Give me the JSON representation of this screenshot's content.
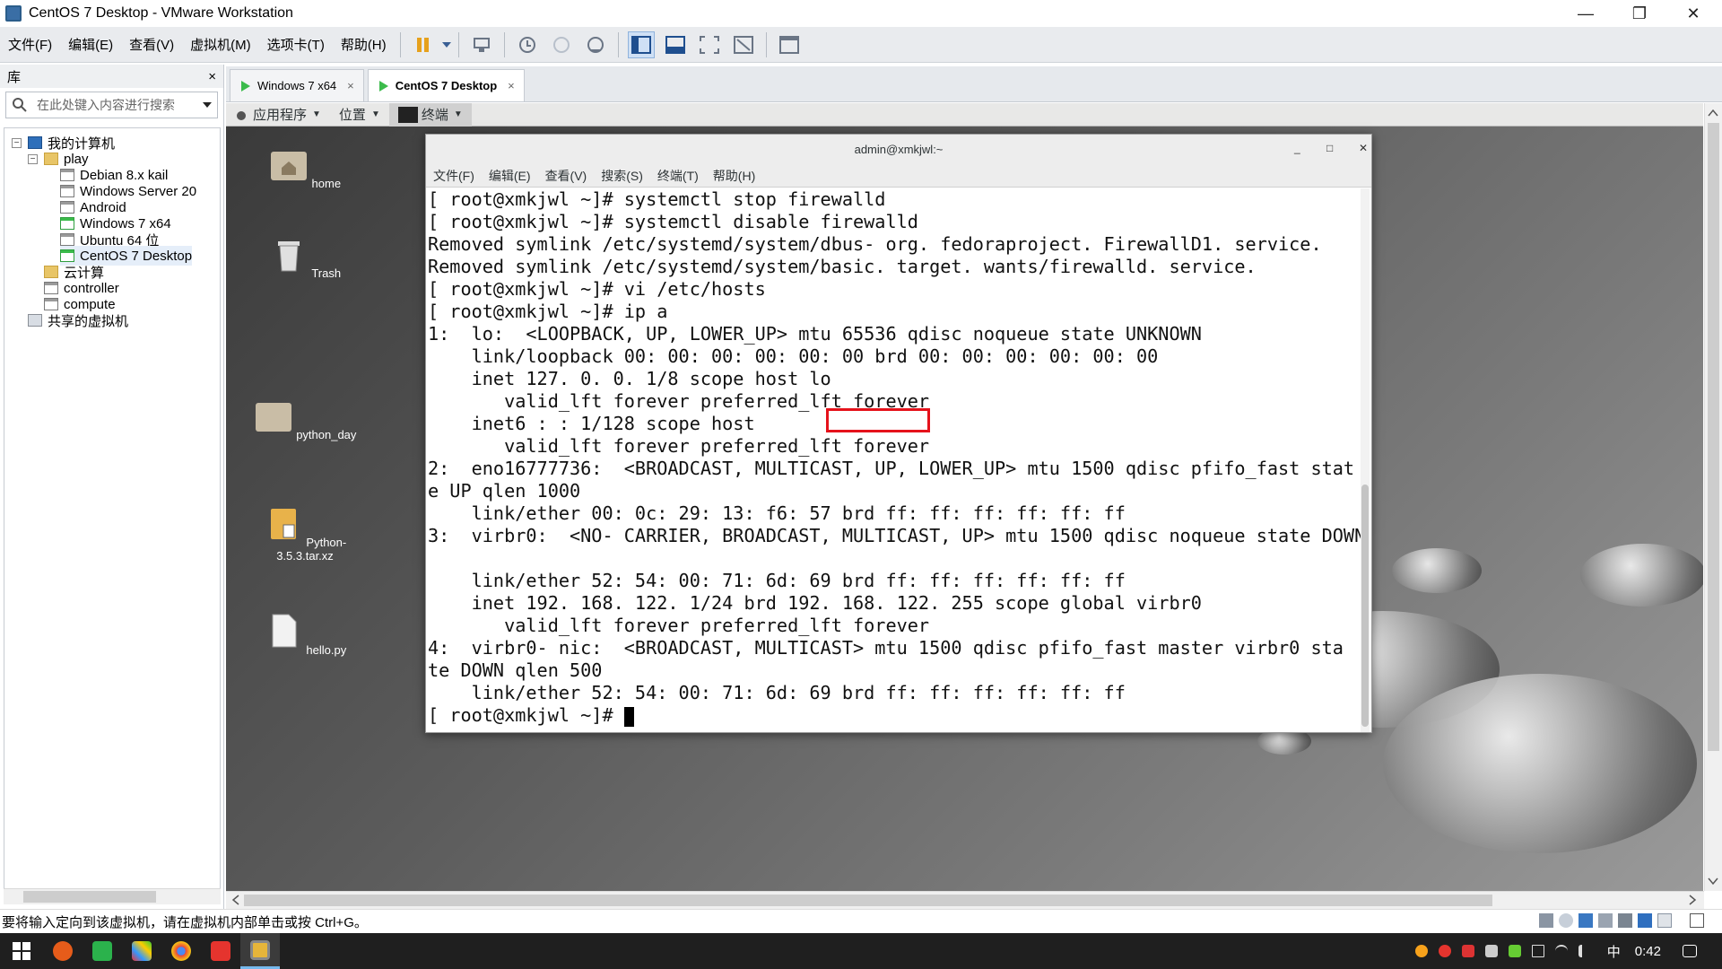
{
  "window": {
    "title": "CentOS 7 Desktop - VMware Workstation"
  },
  "menubar": [
    "文件(F)",
    "编辑(E)",
    "查看(V)",
    "虚拟机(M)",
    "选项卡(T)",
    "帮助(H)"
  ],
  "library": {
    "title": "库",
    "close": "×",
    "search_placeholder": "在此处键入内容进行搜索",
    "tree": {
      "root": "我的计算机",
      "play": "play",
      "vms": [
        "Debian 8.x kail",
        "Windows Server 20",
        "Android",
        "Windows 7 x64",
        "Ubuntu 64 位",
        "CentOS 7 Desktop"
      ],
      "cloud": "云计算",
      "controller": "controller",
      "compute": "compute",
      "shared": "共享的虚拟机"
    }
  },
  "tabs": [
    {
      "label": "Windows 7 x64",
      "close": "×"
    },
    {
      "label": "CentOS 7 Desktop",
      "close": "×"
    }
  ],
  "gnome": {
    "apps": "应用程序",
    "places": "位置",
    "terminal": "终端"
  },
  "desktop": {
    "icons": [
      "home",
      "Trash",
      "python_day",
      "Python-3.5.3.tar.xz",
      "hello.py"
    ]
  },
  "terminal": {
    "title": "admin@xmkjwl:~",
    "menu": [
      "文件(F)",
      "编辑(E)",
      "查看(V)",
      "搜索(S)",
      "终端(T)",
      "帮助(H)"
    ],
    "lines": [
      "[ root@xmkjwl ~]# systemctl stop firewalld",
      "[ root@xmkjwl ~]# systemctl disable firewalld",
      "Removed symlink /etc/systemd/system/dbus- org. fedoraproject. FirewallD1. service.",
      "Removed symlink /etc/systemd/system/basic. target. wants/firewalld. service.",
      "[ root@xmkjwl ~]# vi /etc/hosts",
      "[ root@xmkjwl ~]# ip a",
      "1:  lo:  <LOOPBACK, UP, LOWER_UP> mtu 65536 qdisc noqueue state UNKNOWN",
      "    link/loopback 00: 00: 00: 00: 00: 00 brd 00: 00: 00: 00: 00: 00",
      "    inet 127. 0. 0. 1/8 scope host lo",
      "       valid_lft forever preferred_lft forever",
      "    inet6 : : 1/128 scope host",
      "       valid_lft forever preferred_lft forever",
      "2:  eno16777736:  <BROADCAST, MULTICAST, UP, LOWER_UP> mtu 1500 qdisc pfifo_fast stat",
      "e UP qlen 1000",
      "    link/ether 00: 0c: 29: 13: f6: 57 brd ff: ff: ff: ff: ff: ff",
      "3:  virbr0:  <NO- CARRIER, BROADCAST, MULTICAST, UP> mtu 1500 qdisc noqueue state DOWN",
      "",
      "    link/ether 52: 54: 00: 71: 6d: 69 brd ff: ff: ff: ff: ff: ff",
      "    inet 192. 168. 122. 1/24 brd 192. 168. 122. 255 scope global virbr0",
      "       valid_lft forever preferred_lft forever",
      "4:  virbr0- nic:  <BROADCAST, MULTICAST> mtu 1500 qdisc pfifo_fast master virbr0 sta",
      "te DOWN qlen 500",
      "    link/ether 52: 54: 00: 71: 6d: 69 brd ff: ff: ff: ff: ff: ff"
    ],
    "prompt": "[ root@xmkjwl ~]# "
  },
  "status": {
    "text": "要将输入定向到该虚拟机，请在虚拟机内部单击或按 Ctrl+G。"
  },
  "taskbar": {
    "ime": "中",
    "time": "0:42"
  },
  "colors": {
    "highlight": "#e5121b",
    "vm_on": "#3bbb4b"
  }
}
